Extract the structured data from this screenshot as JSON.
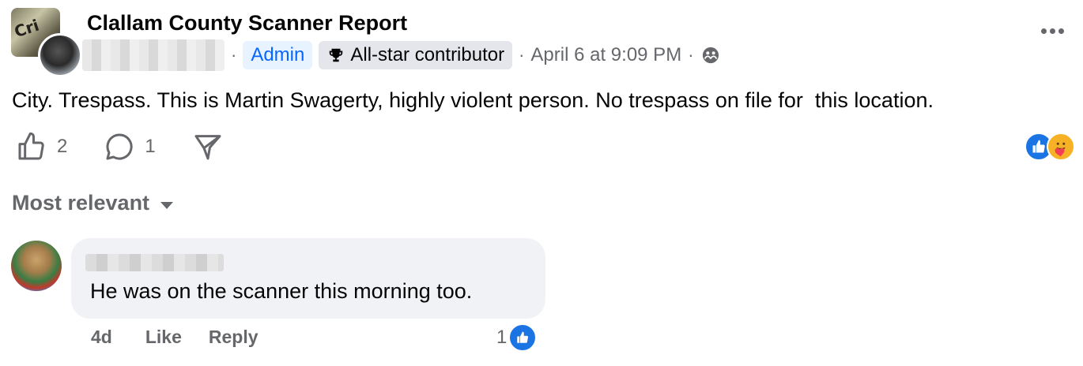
{
  "post": {
    "page_name": "Clallam County Scanner Report",
    "separator": "·",
    "admin_label": "Admin",
    "badge_label": "All-star contributor",
    "timestamp": "April 6 at 9:09 PM",
    "timestamp_separator": "·",
    "visibility_icon": "group-icon",
    "text": "City. Trespass. This is Martin Swagerty, highly violent person. No trespass on file for  this location."
  },
  "actions": {
    "like_count": "2",
    "comment_count": "1",
    "share_icon": "share-icon",
    "reactions": [
      "like",
      "care"
    ]
  },
  "comments_header": {
    "sort_label": "Most relevant"
  },
  "comment": {
    "text": "He was on the scanner this morning too.",
    "age": "4d",
    "like_label": "Like",
    "reply_label": "Reply",
    "reaction_count": "1"
  },
  "colors": {
    "accent": "#0866ff",
    "secondary_text": "#65676b",
    "bubble_bg": "#f0f2f5",
    "admin_bg": "#e7f3ff"
  }
}
